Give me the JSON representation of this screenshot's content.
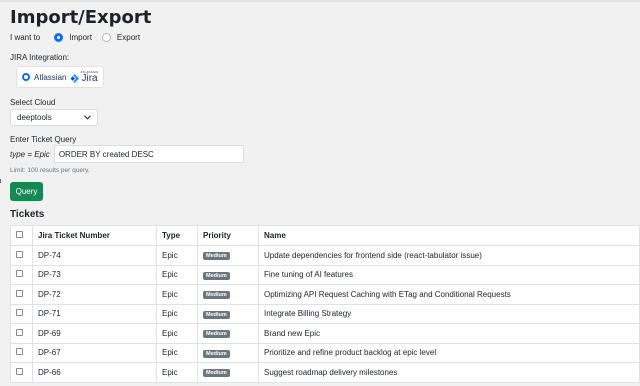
{
  "page": {
    "title": "Import/Export"
  },
  "mode": {
    "label": "I want to",
    "options": [
      "Import",
      "Export"
    ],
    "selected": "Import"
  },
  "integration": {
    "label": "JIRA Integration:",
    "option": "Atlassian",
    "logo_small": "ATLASSIAN",
    "logo_main": "Jira"
  },
  "cloud": {
    "label": "Select Cloud",
    "value": "deeptools"
  },
  "query": {
    "label": "Enter Ticket Query",
    "prefix": "type = Epic",
    "value": "ORDER BY created DESC",
    "hint": "Limit: 100 results per query.",
    "button": "Query"
  },
  "tickets": {
    "title": "Tickets",
    "columns": [
      "Jira Ticket Number",
      "Type",
      "Priority",
      "Name"
    ],
    "rows": [
      {
        "number": "DP-74",
        "type": "Epic",
        "priority": "Medium",
        "name": "Update dependencies for frontend side (react-tabulator issue)"
      },
      {
        "number": "DP-73",
        "type": "Epic",
        "priority": "Medium",
        "name": "Fine tuning of AI features"
      },
      {
        "number": "DP-72",
        "type": "Epic",
        "priority": "Medium",
        "name": "Optimizing API Request Caching with ETag and Conditional Requests"
      },
      {
        "number": "DP-71",
        "type": "Epic",
        "priority": "Medium",
        "name": "Integrate Billing Strategy"
      },
      {
        "number": "DP-69",
        "type": "Epic",
        "priority": "Medium",
        "name": "Brand new Epic"
      },
      {
        "number": "DP-67",
        "type": "Epic",
        "priority": "Medium",
        "name": "Prioritize and refine product backlog at epic level"
      },
      {
        "number": "DP-66",
        "type": "Epic",
        "priority": "Medium",
        "name": "Suggest roadmap delivery milestones"
      }
    ]
  },
  "colors": {
    "primary": "#0d6efd",
    "success": "#198754",
    "badge": "#6c757d",
    "background": "#f1f1f1"
  }
}
